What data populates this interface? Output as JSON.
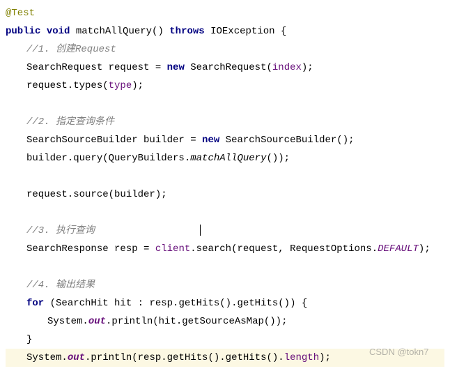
{
  "code": {
    "l1_annotation": "@Test",
    "l2_kw1": "public",
    "l2_kw2": "void",
    "l2_method": " matchAllQuery() ",
    "l2_kw3": "throws",
    "l2_exception": " IOException {",
    "l3_comment": "//1. 创建Request",
    "l4_a": "SearchRequest request = ",
    "l4_kw": "new",
    "l4_b": " SearchRequest(",
    "l4_field": "index",
    "l4_c": ");",
    "l5_a": "request.types(",
    "l5_field": "type",
    "l5_b": ");",
    "l6_comment": "//2. 指定查询条件",
    "l7_a": "SearchSourceBuilder builder = ",
    "l7_kw": "new",
    "l7_b": " SearchSourceBuilder();",
    "l8_a": "builder.query(QueryBuilders.",
    "l8_m": "matchAllQuery",
    "l8_b": "());",
    "l9": "request.source(builder);",
    "l10_comment": "//3. 执行查询",
    "l11_a": "SearchResponse resp = ",
    "l11_client": "client",
    "l11_b": ".search(request, RequestOptions.",
    "l11_def": "DEFAULT",
    "l11_c": ");",
    "l12_comment": "//4. 输出结果",
    "l13_kw": "for",
    "l13_a": " (SearchHit hit : resp.getHits().getHits()) {",
    "l14_a": "System.",
    "l14_out": "out",
    "l14_b": ".println(hit.getSourceAsMap());",
    "l15": "}",
    "l16_a": "System.",
    "l16_out": "out",
    "l16_b": ".println(resp.getHits().getHits().",
    "l16_len": "length",
    "l16_c": ");"
  },
  "watermark": "CSDN @tokn7"
}
